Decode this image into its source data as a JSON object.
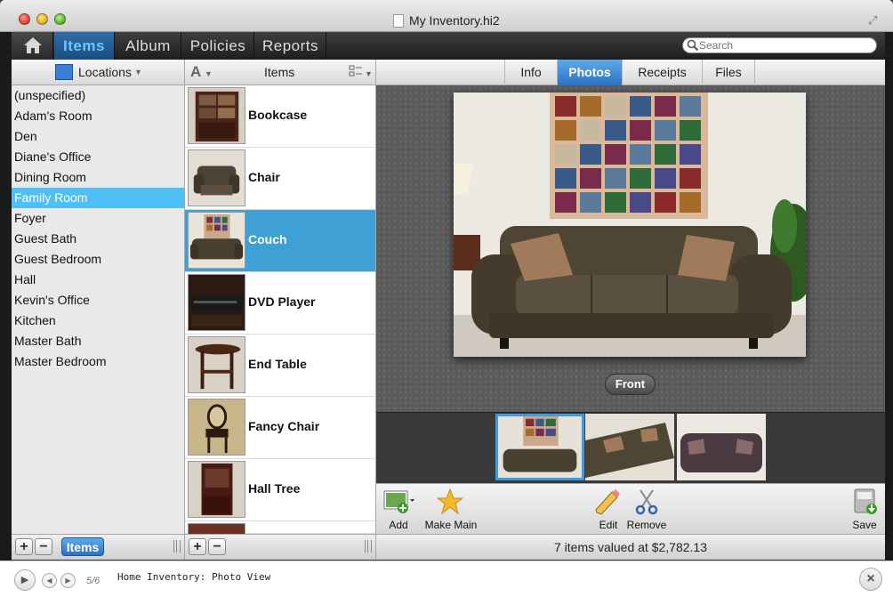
{
  "window": {
    "title": "My Inventory.hi2"
  },
  "nav": {
    "tabs": [
      "Items",
      "Album",
      "Policies",
      "Reports"
    ],
    "active": "Items"
  },
  "search": {
    "placeholder": "Search"
  },
  "locations": {
    "header": "Locations",
    "items": [
      "(unspecified)",
      "Adam's Room",
      "Den",
      "Diane's Office",
      "Dining Room",
      "Family Room",
      "Foyer",
      "Guest Bath",
      "Guest Bedroom",
      "Hall",
      "Kevin's Office",
      "Kitchen",
      "Master Bath",
      "Master Bedroom"
    ],
    "selected": "Family Room",
    "toggle_label": "Items"
  },
  "items_col": {
    "sort_label": "A",
    "header": "Items",
    "rows": [
      "Bookcase",
      "Chair",
      "Couch",
      "DVD Player",
      "End Table",
      "Fancy Chair",
      "Hall Tree"
    ],
    "selected": "Couch"
  },
  "detail_tabs": {
    "tabs": [
      "Info",
      "Photos",
      "Receipts",
      "Files"
    ],
    "active": "Photos"
  },
  "photo": {
    "caption": "Front"
  },
  "actions": {
    "add": "Add",
    "make_main": "Make Main",
    "edit": "Edit",
    "remove": "Remove",
    "save": "Save"
  },
  "status": {
    "summary": "7 items valued at $2,782.13"
  },
  "player": {
    "counter": "5/6",
    "caption": "Home Inventory: Photo View"
  },
  "colors": {
    "accent": "#3fa0d6",
    "selection_location": "#4fc0f5",
    "nav_active": "#6ec4ff"
  }
}
